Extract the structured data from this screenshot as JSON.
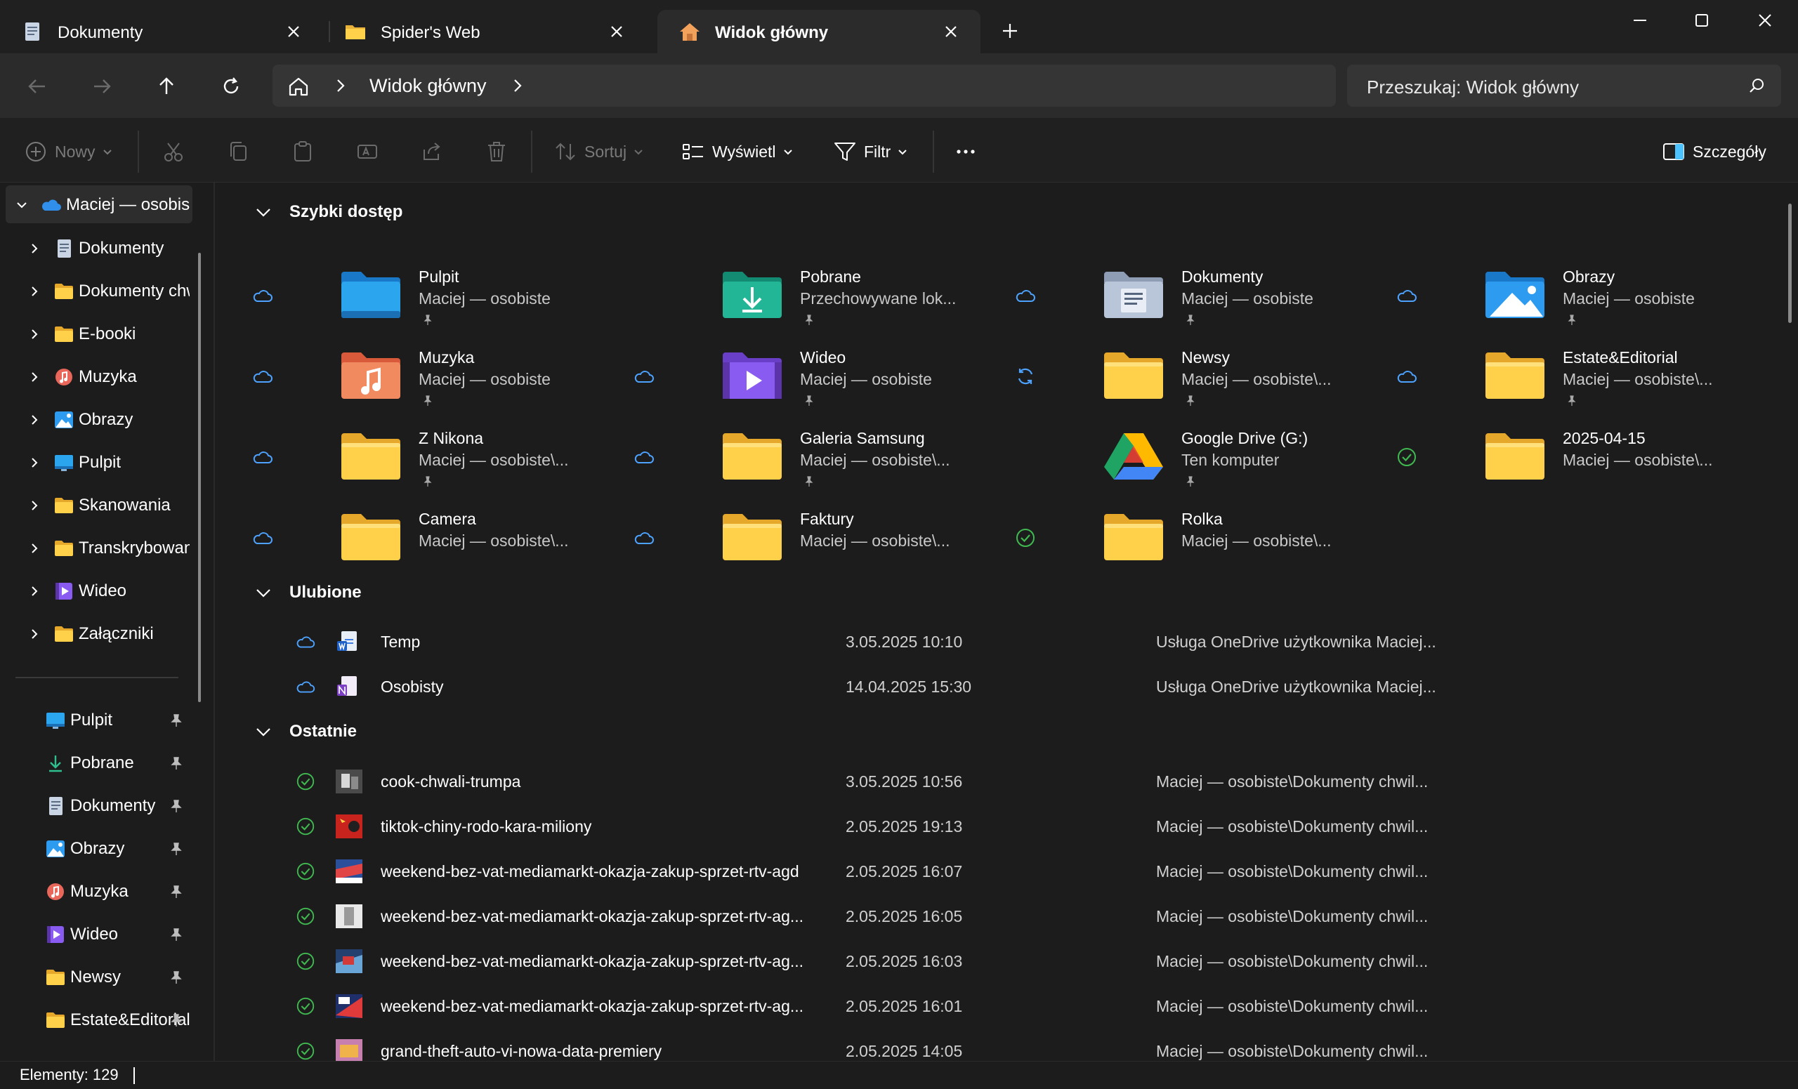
{
  "tabs": [
    {
      "label": "Dokumenty",
      "icon": "document-icon",
      "active": false
    },
    {
      "label": "Spider's Web",
      "icon": "folder-icon",
      "active": false
    },
    {
      "label": "Widok główny",
      "icon": "home-icon",
      "active": true
    }
  ],
  "address": {
    "current": "Widok główny",
    "search_placeholder": "Przeszukaj: Widok główny"
  },
  "toolbar": {
    "new_label": "Nowy",
    "sort_label": "Sortuj",
    "view_label": "Wyświetl",
    "filter_label": "Filtr",
    "details_label": "Szczegóły"
  },
  "sidebar": {
    "root": {
      "label": "Maciej — osobiste"
    },
    "tree": [
      {
        "label": "Dokumenty",
        "icon": "document-icon"
      },
      {
        "label": "Dokumenty chwilowe",
        "icon": "folder-icon"
      },
      {
        "label": "E-booki",
        "icon": "folder-icon"
      },
      {
        "label": "Muzyka",
        "icon": "music-icon"
      },
      {
        "label": "Obrazy",
        "icon": "pictures-icon"
      },
      {
        "label": "Pulpit",
        "icon": "desktop-icon"
      },
      {
        "label": "Skanowania",
        "icon": "folder-icon"
      },
      {
        "label": "Transkrybowane",
        "icon": "folder-icon"
      },
      {
        "label": "Wideo",
        "icon": "video-icon"
      },
      {
        "label": "Załączniki",
        "icon": "folder-icon"
      }
    ],
    "pinned": [
      {
        "label": "Pulpit",
        "icon": "desktop-icon"
      },
      {
        "label": "Pobrane",
        "icon": "download-icon"
      },
      {
        "label": "Dokumenty",
        "icon": "document-icon"
      },
      {
        "label": "Obrazy",
        "icon": "pictures-icon"
      },
      {
        "label": "Muzyka",
        "icon": "music-icon"
      },
      {
        "label": "Wideo",
        "icon": "video-icon"
      },
      {
        "label": "Newsy",
        "icon": "folder-icon"
      },
      {
        "label": "Estate&Editorial",
        "icon": "folder-icon"
      }
    ]
  },
  "quick_access": {
    "title": "Szybki dostęp",
    "items": [
      {
        "name": "Pulpit",
        "sub": "Maciej — osobiste",
        "status": "cloud",
        "icon": "desktop-folder-icon"
      },
      {
        "name": "Pobrane",
        "sub": "Przechowywane lok...",
        "status": "none",
        "icon": "downloads-folder-icon"
      },
      {
        "name": "Dokumenty",
        "sub": "Maciej — osobiste",
        "status": "cloud",
        "icon": "documents-folder-icon"
      },
      {
        "name": "Obrazy",
        "sub": "Maciej — osobiste",
        "status": "cloud",
        "icon": "pictures-folder-icon"
      },
      {
        "name": "Muzyka",
        "sub": "Maciej — osobiste",
        "status": "cloud",
        "icon": "music-folder-icon"
      },
      {
        "name": "Wideo",
        "sub": "Maciej — osobiste",
        "status": "cloud",
        "icon": "video-folder-icon"
      },
      {
        "name": "Newsy",
        "sub": "Maciej — osobiste\\...",
        "status": "sync",
        "icon": "folder-icon"
      },
      {
        "name": "Estate&Editorial",
        "sub": "Maciej — osobiste\\...",
        "status": "cloud",
        "icon": "folder-icon"
      },
      {
        "name": "Z Nikona",
        "sub": "Maciej — osobiste\\...",
        "status": "cloud",
        "icon": "folder-icon"
      },
      {
        "name": "Galeria Samsung",
        "sub": "Maciej — osobiste\\...",
        "status": "cloud",
        "icon": "folder-icon"
      },
      {
        "name": "Google Drive (G:)",
        "sub": "Ten komputer",
        "status": "none",
        "icon": "google-drive-icon"
      },
      {
        "name": "2025-04-15",
        "sub": "Maciej — osobiste\\...",
        "status": "ok",
        "icon": "folder-icon"
      },
      {
        "name": "Camera",
        "sub": "Maciej — osobiste\\...",
        "status": "cloud",
        "icon": "folder-icon"
      },
      {
        "name": "Faktury",
        "sub": "Maciej — osobiste\\...",
        "status": "cloud",
        "icon": "folder-icon"
      },
      {
        "name": "Rolka",
        "sub": "Maciej — osobiste\\...",
        "status": "ok",
        "icon": "folder-icon"
      }
    ]
  },
  "favorites": {
    "title": "Ulubione",
    "items": [
      {
        "name": "Temp",
        "date": "3.05.2025 10:10",
        "location": "Usługa OneDrive użytkownika Maciej...",
        "status": "cloud"
      },
      {
        "name": "Osobisty",
        "date": "14.04.2025 15:30",
        "location": "Usługa OneDrive użytkownika Maciej...",
        "status": "cloud"
      }
    ]
  },
  "recent": {
    "title": "Ostatnie",
    "items": [
      {
        "name": "cook-chwali-trumpa",
        "date": "3.05.2025 10:56",
        "location": "Maciej — osobiste\\Dokumenty chwil...",
        "status": "ok"
      },
      {
        "name": "tiktok-chiny-rodo-kara-miliony",
        "date": "2.05.2025 19:13",
        "location": "Maciej — osobiste\\Dokumenty chwil...",
        "status": "ok"
      },
      {
        "name": "weekend-bez-vat-mediamarkt-okazja-zakup-sprzet-rtv-agd",
        "date": "2.05.2025 16:07",
        "location": "Maciej — osobiste\\Dokumenty chwil...",
        "status": "ok"
      },
      {
        "name": "weekend-bez-vat-mediamarkt-okazja-zakup-sprzet-rtv-ag...",
        "date": "2.05.2025 16:05",
        "location": "Maciej — osobiste\\Dokumenty chwil...",
        "status": "ok"
      },
      {
        "name": "weekend-bez-vat-mediamarkt-okazja-zakup-sprzet-rtv-ag...",
        "date": "2.05.2025 16:03",
        "location": "Maciej — osobiste\\Dokumenty chwil...",
        "status": "ok"
      },
      {
        "name": "weekend-bez-vat-mediamarkt-okazja-zakup-sprzet-rtv-ag...",
        "date": "2.05.2025 16:01",
        "location": "Maciej — osobiste\\Dokumenty chwil...",
        "status": "ok"
      },
      {
        "name": "grand-theft-auto-vi-nowa-data-premiery",
        "date": "2.05.2025 14:05",
        "location": "Maciej — osobiste\\Dokumenty chwil...",
        "status": "ok"
      }
    ]
  },
  "statusbar": {
    "items_count": "Elementy: 129"
  },
  "colors": {
    "accent": "#4cc2ff",
    "folder_yellow": "#ffd04a",
    "cloud_blue": "#4da3ff",
    "ok_green": "#3fb950",
    "background": "#1c1c1c"
  }
}
